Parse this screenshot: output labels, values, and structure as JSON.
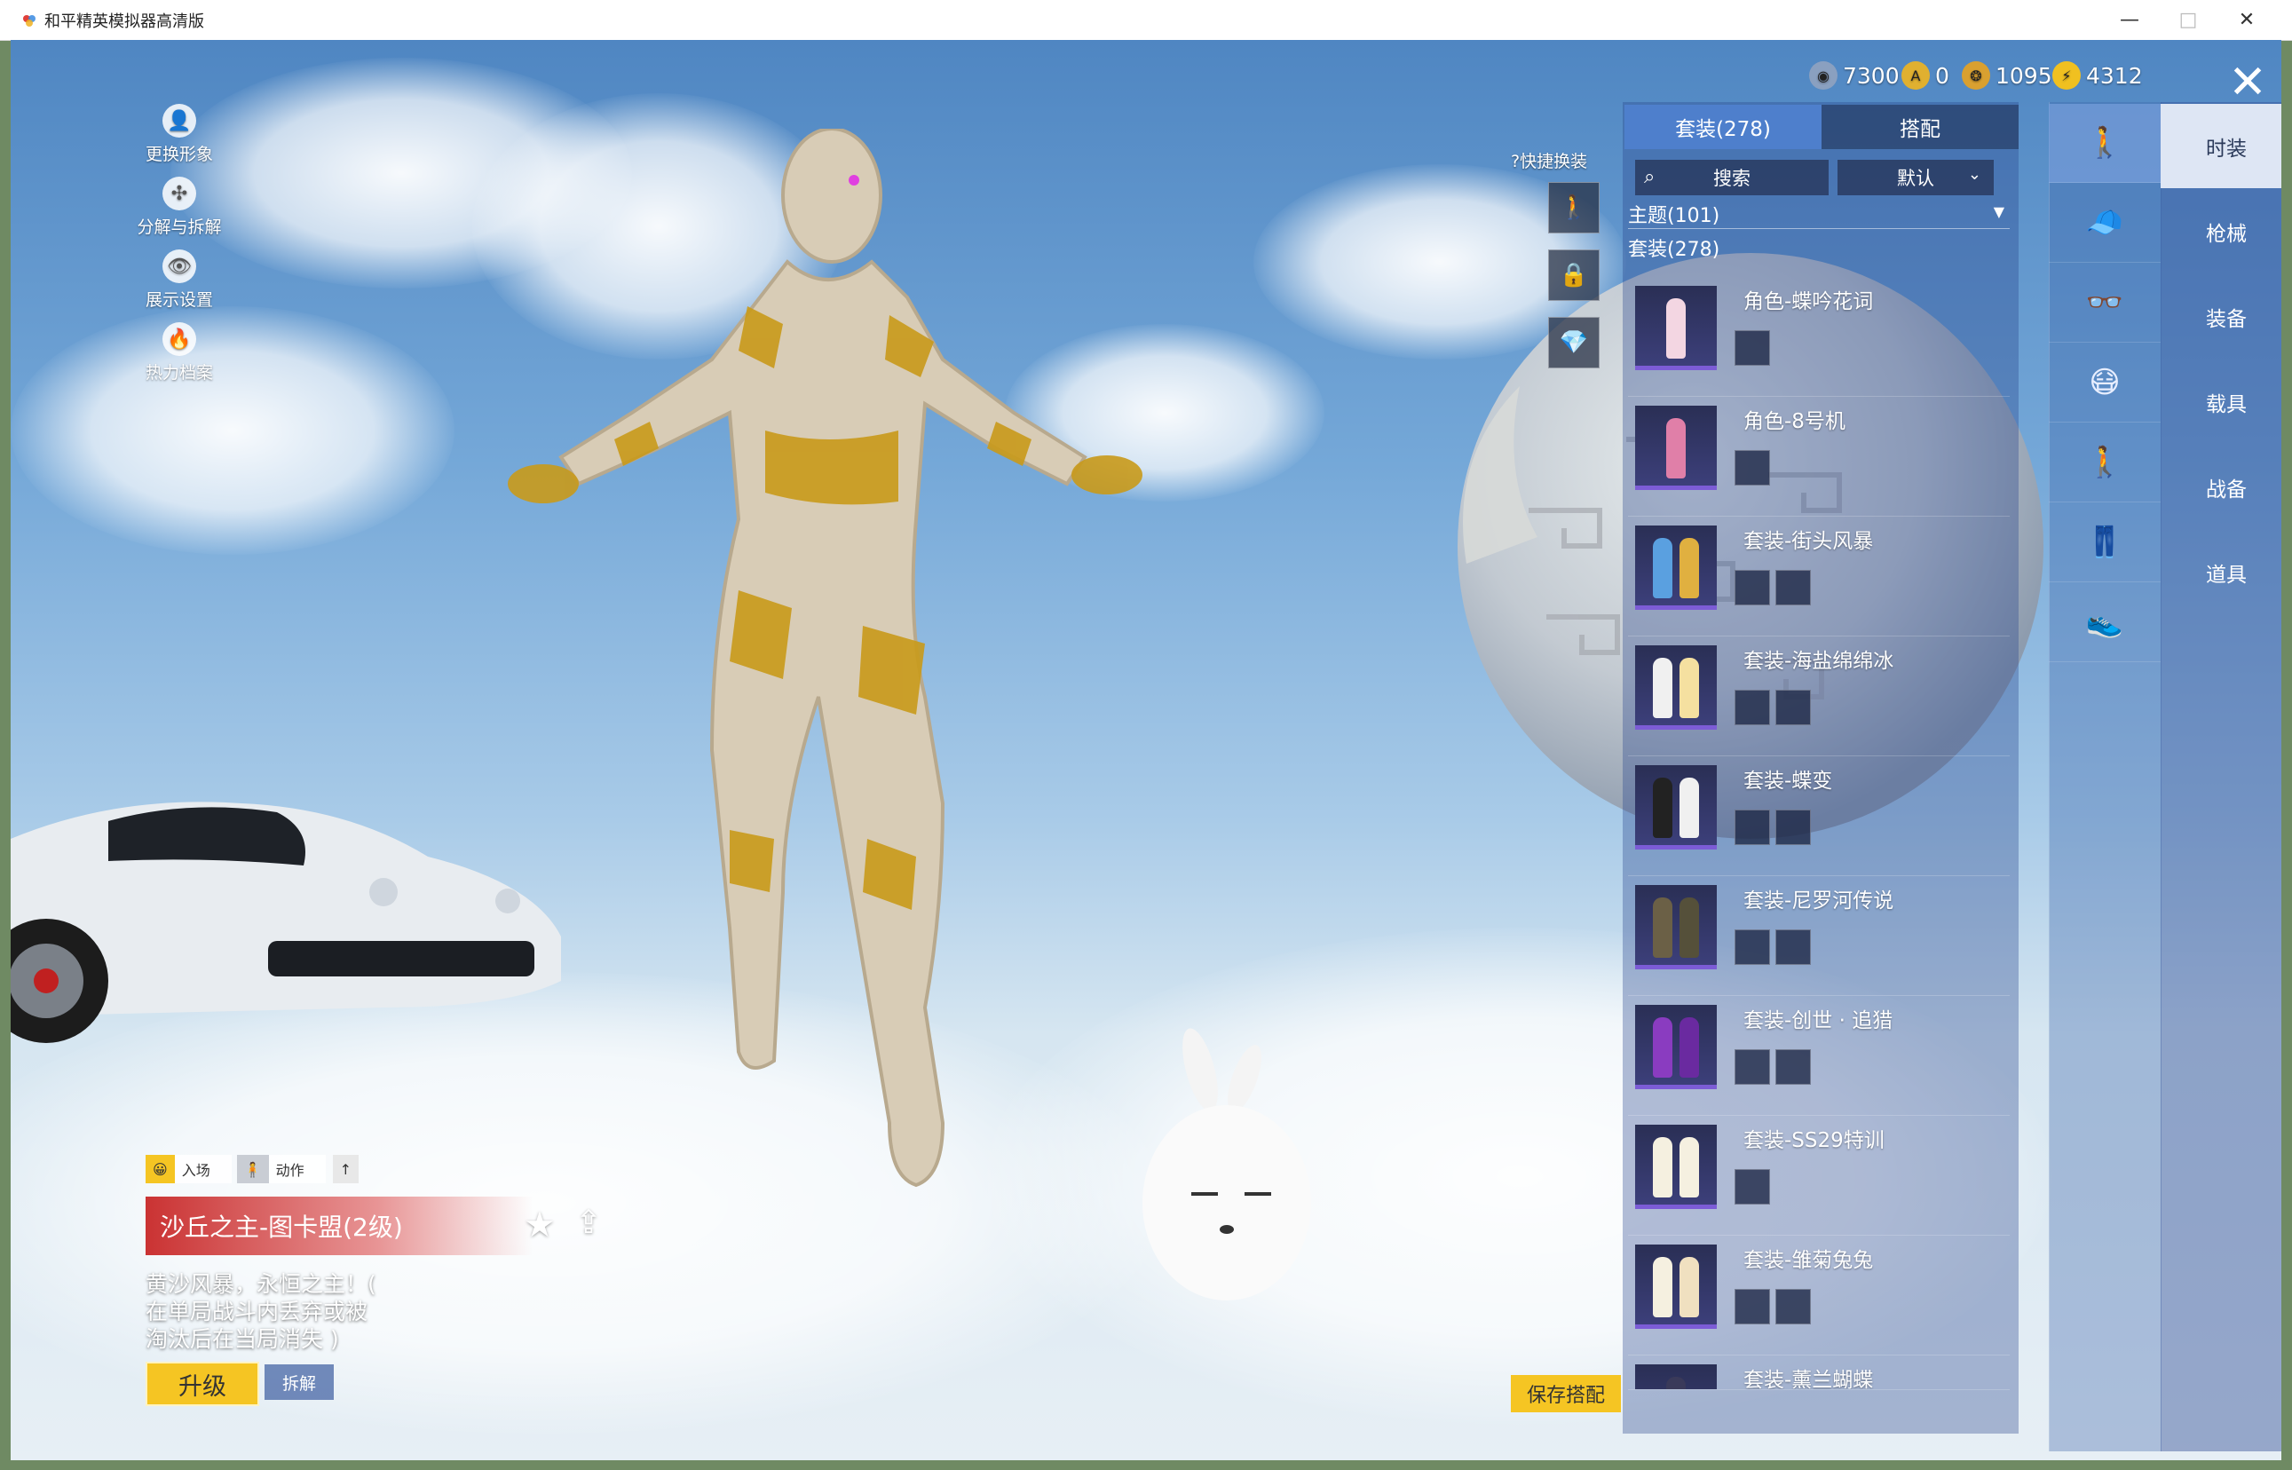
{
  "window": {
    "title": "和平精英模拟器高清版",
    "minimize": "—",
    "maximize": "□",
    "close": "✕"
  },
  "left_menu": [
    {
      "label": "更换形象",
      "icon": "👤"
    },
    {
      "label": "分解与拆解",
      "icon": "✣"
    },
    {
      "label": "展示设置",
      "icon": "👁"
    },
    {
      "label": "热力档案",
      "icon": "🔥"
    }
  ],
  "currencies": [
    {
      "value": "7300",
      "color": "#8aa0c0",
      "icon": "◉"
    },
    {
      "value": "0",
      "color": "#e0b030",
      "icon": "A"
    },
    {
      "value": "1095",
      "color": "#d9a030",
      "icon": "❂"
    },
    {
      "value": "4312",
      "color": "#f0c020",
      "icon": "⚡"
    }
  ],
  "quick_change": {
    "label": "?快捷换装",
    "slots": [
      "🚶",
      "🔒",
      "💎"
    ]
  },
  "panel": {
    "tabs": [
      "套装(278)",
      "搭配"
    ],
    "search_placeholder": "搜索",
    "sort": "默认",
    "theme": "主题(101)",
    "suit_count": "套装(278)",
    "items": [
      {
        "name": "角色-蝶吟花词",
        "subs": 1,
        "colors": [
          "#f3d6e2"
        ]
      },
      {
        "name": "角色-8号机",
        "subs": 1,
        "colors": [
          "#e07fa8"
        ]
      },
      {
        "name": "套装-街头风暴",
        "subs": 2,
        "colors": [
          "#5aa0e0",
          "#e0b040"
        ]
      },
      {
        "name": "套装-海盐绵绵冰",
        "subs": 2,
        "colors": [
          "#f0f0f0",
          "#f5e0a0"
        ]
      },
      {
        "name": "套装-蝶变",
        "subs": 2,
        "colors": [
          "#222222",
          "#f0f0f0"
        ]
      },
      {
        "name": "套装-尼罗河传说",
        "subs": 2,
        "colors": [
          "#6b6046",
          "#55503a"
        ]
      },
      {
        "name": "套装-创世 · 追猎",
        "subs": 2,
        "colors": [
          "#8a3cc0",
          "#6a2aa0"
        ]
      },
      {
        "name": "套装-SS29特训",
        "subs": 1,
        "colors": [
          "#f5f0e0",
          "#f5f0e0"
        ]
      },
      {
        "name": "套装-雏菊兔兔",
        "subs": 2,
        "colors": [
          "#f5f0e0",
          "#f0e0c0"
        ]
      },
      {
        "name": "套装-薰兰蝴蝶",
        "subs": 0,
        "colors": [
          "#3a3a5a"
        ]
      }
    ]
  },
  "category_icons": [
    "🚶",
    "🧢",
    "👓",
    "😷",
    "🚶",
    "👖",
    "👟"
  ],
  "nav": [
    "时装",
    "枪械",
    "装备",
    "载具",
    "战备",
    "道具"
  ],
  "bottom": {
    "entrance": "入场",
    "action": "动作",
    "up_arrow": "↑",
    "title": "沙丘之主-图卡盟(2级)",
    "desc_lines": [
      "黄沙风暴，永恒之主！(",
      "在单局战斗内丢弃或被",
      "淘汰后在当局消失 )"
    ],
    "upgrade": "升级",
    "disassemble": "拆解",
    "save": "保存搭配"
  }
}
